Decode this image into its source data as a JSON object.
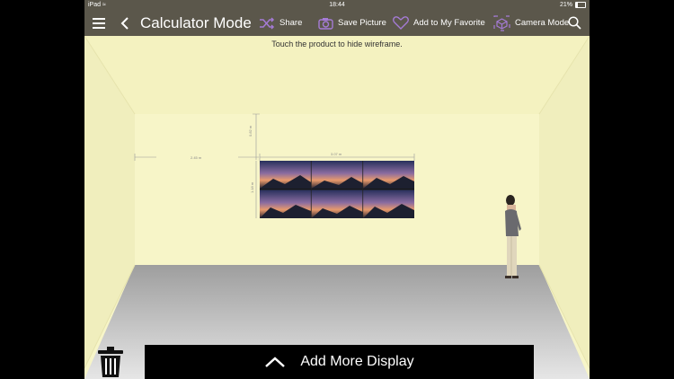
{
  "statusbar": {
    "device": "iPad",
    "time": "18:44",
    "battery": "21%"
  },
  "nav": {
    "title": "Calculator Mode",
    "share": "Share",
    "save_picture": "Save Picture",
    "favorite": "Add to My Favorite",
    "camera_mode": "Camera Mode"
  },
  "hint": "Touch the product to hide wireframe.",
  "dimensions": {
    "top_gap": "0.82 m",
    "left_gap": "2.45 m",
    "width": "3.07 m",
    "height": "1.18 m"
  },
  "bottom_bar": {
    "add_more_label": "Add More Display"
  },
  "colors": {
    "toolbar": "#5b574b",
    "accent": "#a57bd6",
    "wall": "#f7f5c8",
    "floor": "#b9b9b9"
  }
}
